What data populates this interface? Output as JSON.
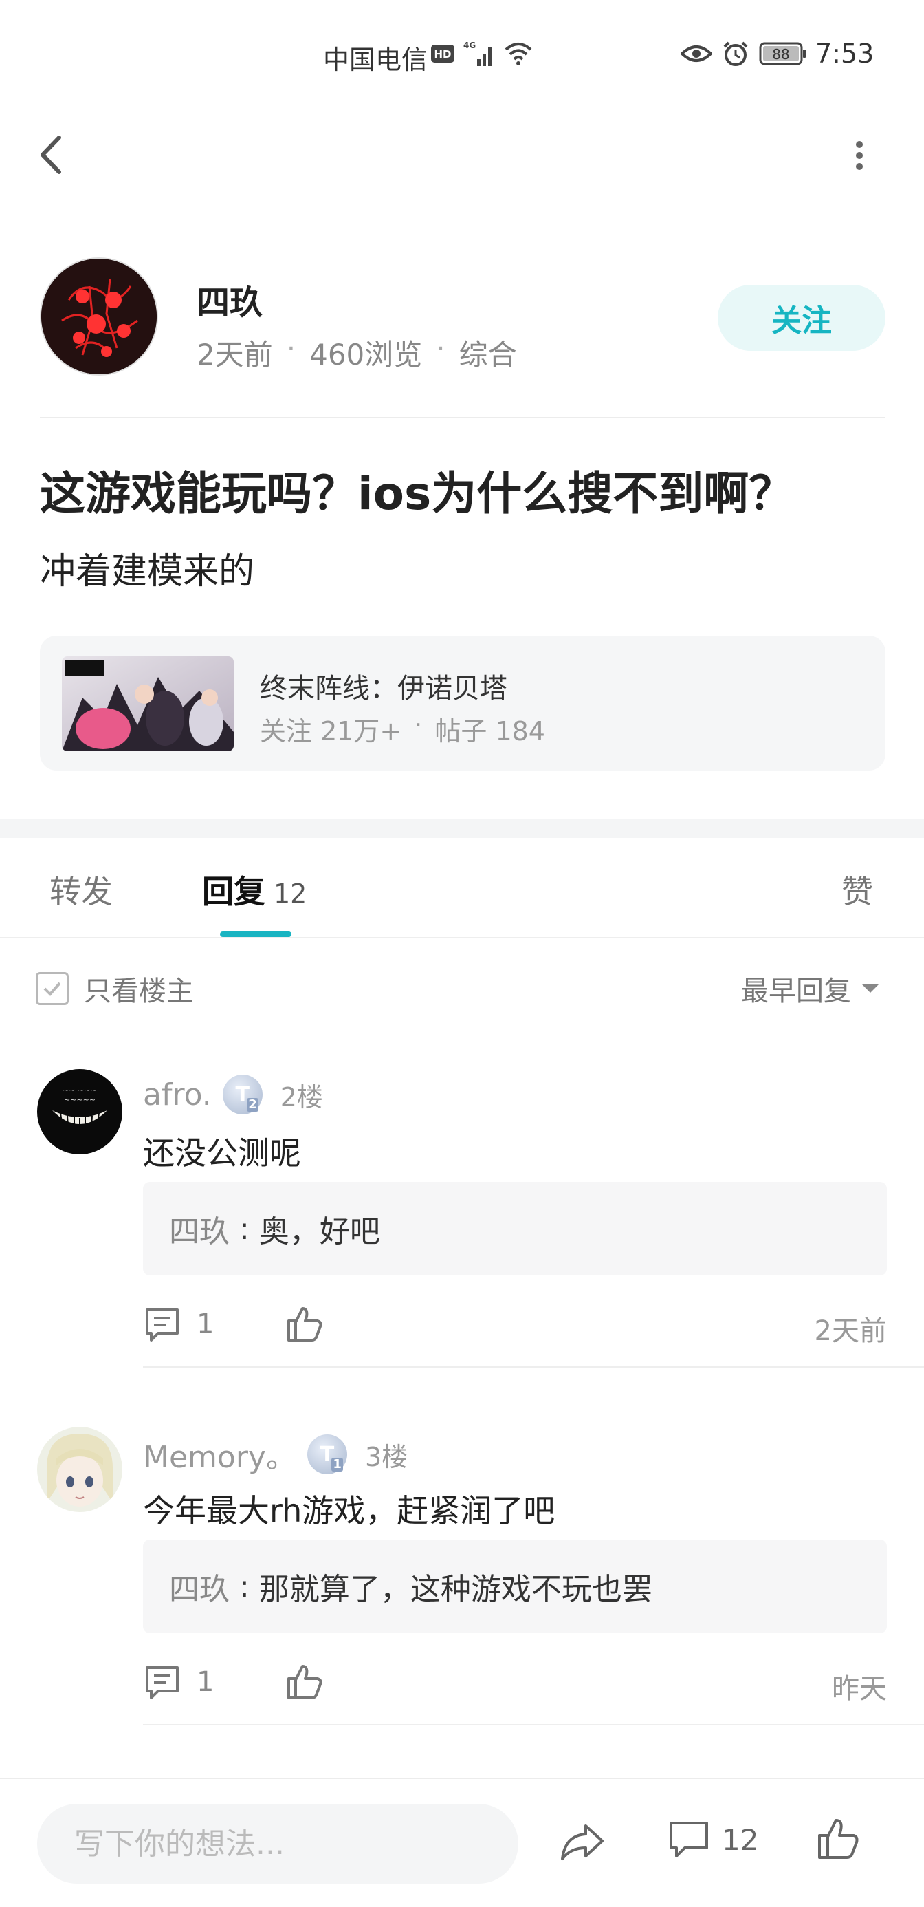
{
  "status_bar": {
    "carrier": "中国电信",
    "battery": "88",
    "time": "7:53"
  },
  "author": {
    "name": "四玖",
    "time_ago": "2天前",
    "views": "460浏览",
    "category": "综合",
    "follow_label": "关注"
  },
  "post": {
    "title": "这游戏能玩吗？ios为什么搜不到啊？",
    "body": "冲着建模来的"
  },
  "game_card": {
    "name": "终末阵线：伊诺贝塔",
    "followers": "关注 21万+",
    "posts": "帖子 184"
  },
  "tabs": {
    "forward": "转发",
    "reply": "回复",
    "reply_count": "12",
    "like": "赞"
  },
  "filter": {
    "only_op": "只看楼主",
    "sort": "最早回复"
  },
  "comments": [
    {
      "username": "afro.",
      "badge_level": "2",
      "floor": "2楼",
      "text": "还没公测呢",
      "reply_user": "四玖",
      "reply_colon": ":",
      "reply_text": "奥，好吧",
      "reply_count": "1",
      "time": "2天前"
    },
    {
      "username": "Memory。",
      "badge_level": "1",
      "floor": "3楼",
      "text": "今年最大rh游戏，赶紧润了吧",
      "reply_user": "四玖",
      "reply_colon": ":",
      "reply_text": "那就算了，这种游戏不玩也罢",
      "reply_count": "1",
      "time": "昨天"
    }
  ],
  "bottom_bar": {
    "input_placeholder": "写下你的想法...",
    "comment_count": "12"
  },
  "colors": {
    "accent": "#19b4c2",
    "follow_bg": "#e8f8f8"
  }
}
